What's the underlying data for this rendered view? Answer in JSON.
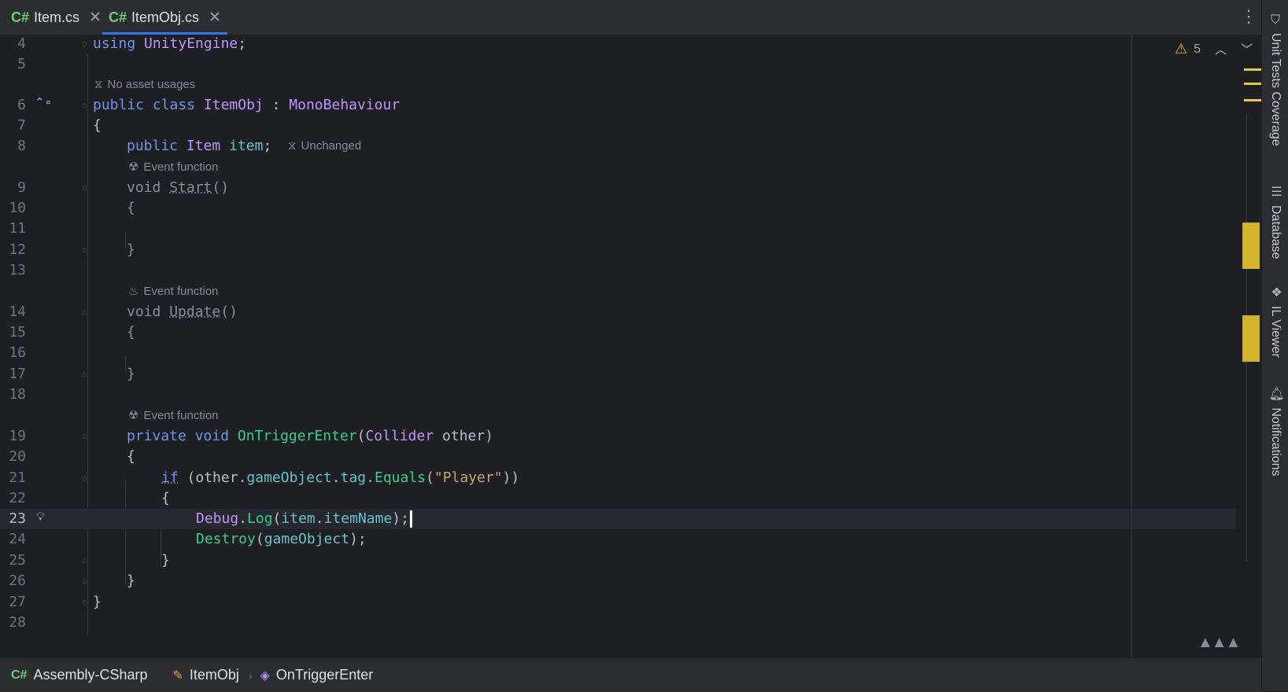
{
  "tabs": [
    {
      "lang": "C#",
      "label": "Item.cs",
      "close": "✕"
    },
    {
      "lang": "C#",
      "label": "ItemObj.cs",
      "close": "✕",
      "active": true
    }
  ],
  "inspection": {
    "warnings": "5"
  },
  "code_lines": [
    {
      "n": "4"
    },
    {
      "n": "5"
    },
    {
      "n": "6"
    },
    {
      "n": "7"
    },
    {
      "n": "8"
    },
    {
      "n": "9"
    },
    {
      "n": "10"
    },
    {
      "n": "11"
    },
    {
      "n": "12"
    },
    {
      "n": "13"
    },
    {
      "n": "14"
    },
    {
      "n": "15"
    },
    {
      "n": "16"
    },
    {
      "n": "17"
    },
    {
      "n": "18"
    },
    {
      "n": "19"
    },
    {
      "n": "20"
    },
    {
      "n": "21"
    },
    {
      "n": "22"
    },
    {
      "n": "23"
    },
    {
      "n": "24"
    },
    {
      "n": "25"
    },
    {
      "n": "26"
    },
    {
      "n": "27"
    },
    {
      "n": "28"
    }
  ],
  "code": {
    "using_kw": "using",
    "using_ns": "UnityEngine",
    "semicolon": ";",
    "public": "public",
    "class": "class",
    "class_name": "ItemObj",
    "colon": ":",
    "base": "MonoBehaviour",
    "open_brace": "{",
    "close_brace": "}",
    "field_type": "Item",
    "field_name": "item",
    "void": "void",
    "start": "Start",
    "update": "Update",
    "parens": "()",
    "private": "private",
    "on_trigger": "OnTriggerEnter",
    "collider": "Collider",
    "other_param": "other",
    "if_kw": "if",
    "cond_other": "other",
    "cond_go": "gameObject",
    "cond_tag": "tag",
    "cond_equals": "Equals",
    "cond_str": "\"Player\"",
    "debug": "Debug",
    "log": "Log",
    "item_ref": "item",
    "item_name": "itemName",
    "destroy": "Destroy",
    "gameobject_arg": "gameObject"
  },
  "hints": {
    "no_asset_usages": "No asset usages",
    "unchanged": "Unchanged",
    "event_function": "Event function"
  },
  "toolwindows": [
    {
      "label": "Unit Tests Coverage",
      "icon": "shield-icon"
    },
    {
      "label": "Database",
      "icon": "database-icon"
    },
    {
      "label": "IL Viewer",
      "icon": "il-viewer-icon"
    },
    {
      "label": "Notifications",
      "icon": "bell-icon"
    }
  ],
  "breadcrumbs": [
    {
      "label": "Assembly-CSharp",
      "icon": "csharp-project-icon"
    },
    {
      "label": "ItemObj",
      "icon": "class-icon"
    },
    {
      "label": "OnTriggerEnter",
      "icon": "method-icon"
    }
  ],
  "colors": {
    "keyword": "#6c95eb",
    "type": "#c191ff",
    "field": "#66c3cc",
    "method": "#39cc8f",
    "string": "#c9a26d",
    "accent": "#3574f0",
    "warning": "#f0a732"
  }
}
